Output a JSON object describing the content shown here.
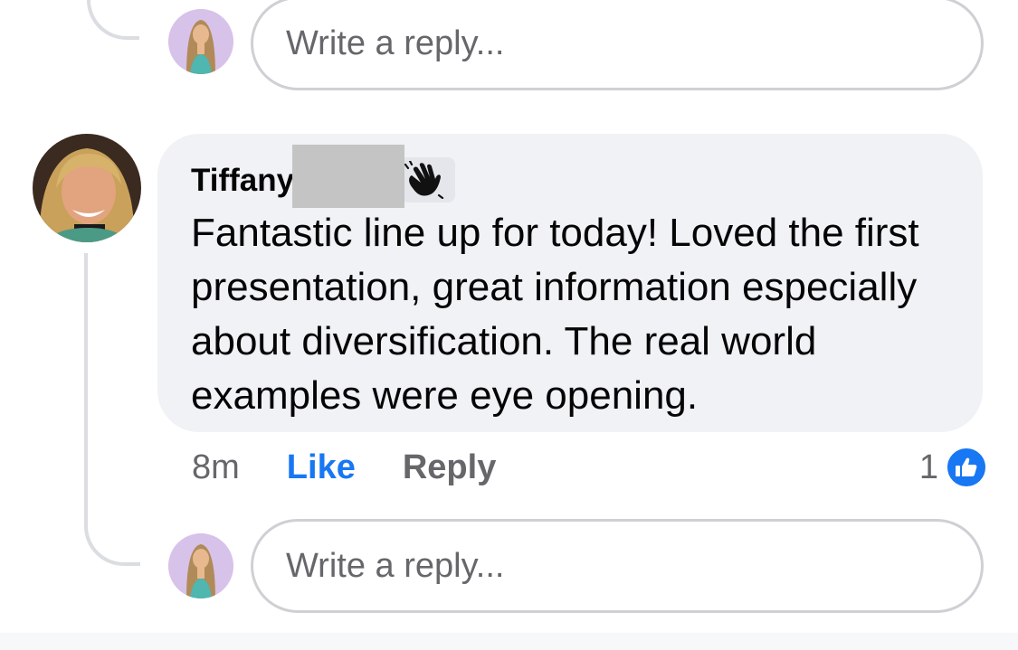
{
  "reply_box_top": {
    "placeholder": "Write a reply..."
  },
  "comment": {
    "author": "Tiffany",
    "badge_icon": "waving-hand-icon",
    "text": "Fantastic line up for today! Loved the first presentation, great information especially about diversification. The real world examples were eye opening.",
    "timestamp": "8m",
    "like_label": "Like",
    "reply_label": "Reply",
    "reaction_count": "1",
    "reaction_icon": "thumbs-up-icon"
  },
  "reply_box_bottom": {
    "placeholder": "Write a reply..."
  },
  "colors": {
    "accent": "#1877f2",
    "bubble": "#f0f2f5",
    "muted_text": "#65676b",
    "border": "#ced0d4"
  }
}
